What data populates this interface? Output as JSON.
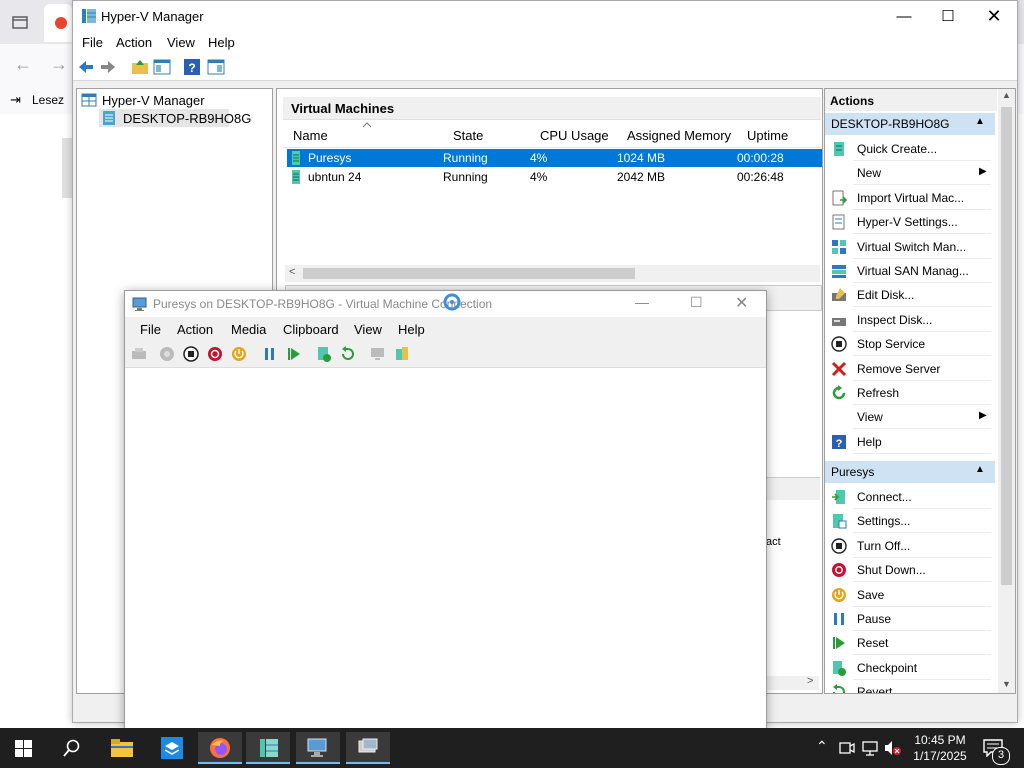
{
  "browser": {
    "bookmark_label": "Lesez"
  },
  "hyperv": {
    "title": "Hyper-V Manager",
    "menu": [
      "File",
      "Action",
      "View",
      "Help"
    ],
    "tree": {
      "root": "Hyper-V Manager",
      "server": "DESKTOP-RB9HO8G"
    },
    "vm_panel": {
      "title": "Virtual Machines",
      "columns": [
        "Name",
        "State",
        "CPU Usage",
        "Assigned Memory",
        "Uptime"
      ],
      "rows": [
        {
          "name": "Puresys",
          "state": "Running",
          "cpu": "4%",
          "memory": "1024 MB",
          "uptime": "00:00:28"
        },
        {
          "name": "ubntun 24",
          "state": "Running",
          "cpu": "4%",
          "memory": "2042 MB",
          "uptime": "00:26:48"
        }
      ]
    },
    "partial_text": "tact",
    "actions": {
      "title": "Actions",
      "server_section": "DESKTOP-RB9HO8G",
      "server_items": [
        {
          "label": "Quick Create...",
          "icon": "quick-create-icon"
        },
        {
          "label": "New",
          "icon": "none",
          "submenu": true
        },
        {
          "label": "Import Virtual Mac...",
          "icon": "import-icon"
        },
        {
          "label": "Hyper-V Settings...",
          "icon": "settings-icon"
        },
        {
          "label": "Virtual Switch Man...",
          "icon": "switch-icon"
        },
        {
          "label": "Virtual SAN Manag...",
          "icon": "san-icon"
        },
        {
          "label": "Edit Disk...",
          "icon": "edit-disk-icon"
        },
        {
          "label": "Inspect Disk...",
          "icon": "inspect-disk-icon"
        },
        {
          "label": "Stop Service",
          "icon": "stop-service-icon"
        },
        {
          "label": "Remove Server",
          "icon": "remove-icon"
        },
        {
          "label": "Refresh",
          "icon": "refresh-icon"
        },
        {
          "label": "View",
          "icon": "none",
          "submenu": true
        },
        {
          "label": "Help",
          "icon": "help-icon"
        }
      ],
      "vm_section": "Puresys",
      "vm_items": [
        {
          "label": "Connect...",
          "icon": "connect-icon"
        },
        {
          "label": "Settings...",
          "icon": "vm-settings-icon"
        },
        {
          "label": "Turn Off...",
          "icon": "turn-off-icon"
        },
        {
          "label": "Shut Down...",
          "icon": "shut-down-icon"
        },
        {
          "label": "Save",
          "icon": "save-icon"
        },
        {
          "label": "Pause",
          "icon": "pause-icon"
        },
        {
          "label": "Reset",
          "icon": "reset-icon"
        },
        {
          "label": "Checkpoint",
          "icon": "checkpoint-icon"
        },
        {
          "label": "Revert...",
          "icon": "revert-icon"
        }
      ]
    }
  },
  "vmconnect": {
    "title": "Puresys on DESKTOP-RB9HO8G - Virtual Machine Connection",
    "menu": [
      "File",
      "Action",
      "Media",
      "Clipboard",
      "View",
      "Help"
    ]
  },
  "taskbar": {
    "time": "10:45 PM",
    "date": "1/17/2025",
    "notification_count": "3"
  },
  "colors": {
    "selection": "#0078d7",
    "actions_header": "#cfe2f3",
    "taskbar": "#1f1f1f"
  }
}
